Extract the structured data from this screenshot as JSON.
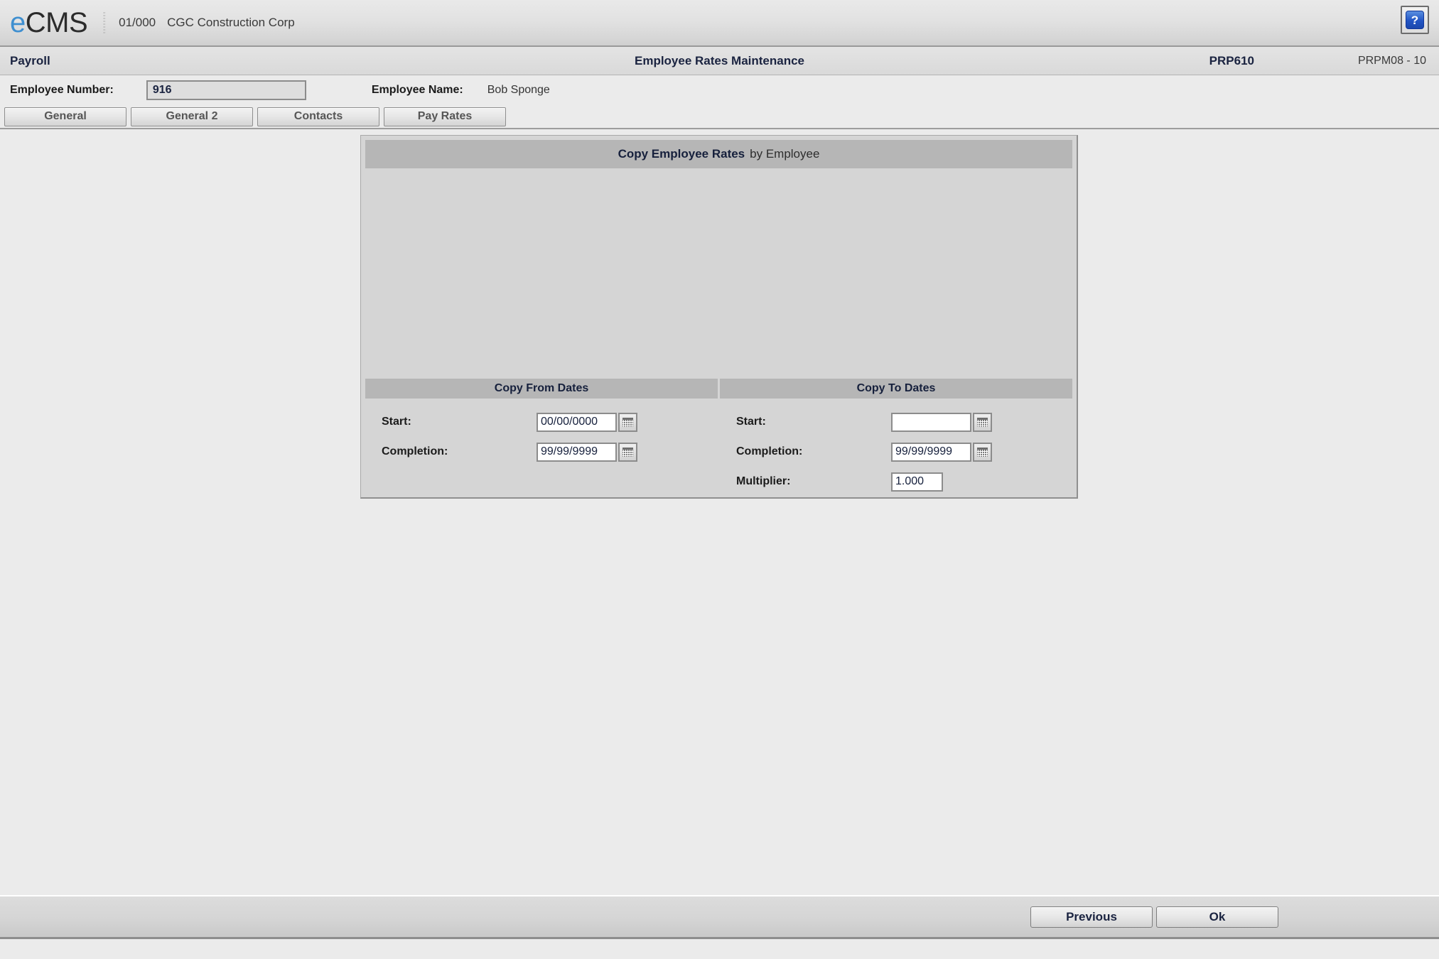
{
  "brand": {
    "logo_e": "e",
    "logo_cms": "CMS",
    "company_code": "01/000",
    "company_name": "CGC Construction Corp",
    "help_glyph": "?",
    "accent_color": "#3f8fd0"
  },
  "titlebar": {
    "module": "Payroll",
    "title": "Employee Rates Maintenance",
    "program_id": "PRP610",
    "screen_id": "PRPM08 - 10"
  },
  "employee": {
    "number_label": "Employee Number:",
    "number_value": "916",
    "name_label": "Employee Name:",
    "name_value": "Bob Sponge"
  },
  "tabs": [
    {
      "label": "General"
    },
    {
      "label": "General 2"
    },
    {
      "label": "Contacts"
    },
    {
      "label": "Pay Rates"
    }
  ],
  "panel": {
    "header_bold": "Copy Employee Rates",
    "header_light": "by Employee",
    "columns": [
      {
        "heading": "Copy From Dates",
        "fields": [
          {
            "label": "Start:",
            "value": "00/00/0000",
            "type": "date",
            "icon": "calendar-icon"
          },
          {
            "label": "Completion:",
            "value": "99/99/9999",
            "type": "date",
            "icon": "calendar-icon"
          }
        ]
      },
      {
        "heading": "Copy To Dates",
        "fields": [
          {
            "label": "Start:",
            "value": "",
            "type": "date",
            "icon": "calendar-icon"
          },
          {
            "label": "Completion:",
            "value": "99/99/9999",
            "type": "date",
            "icon": "calendar-icon"
          },
          {
            "label": "Multiplier:",
            "value": "1.000",
            "type": "number",
            "icon": ""
          }
        ]
      }
    ]
  },
  "footer": {
    "previous_label": "Previous",
    "ok_label": "Ok"
  }
}
